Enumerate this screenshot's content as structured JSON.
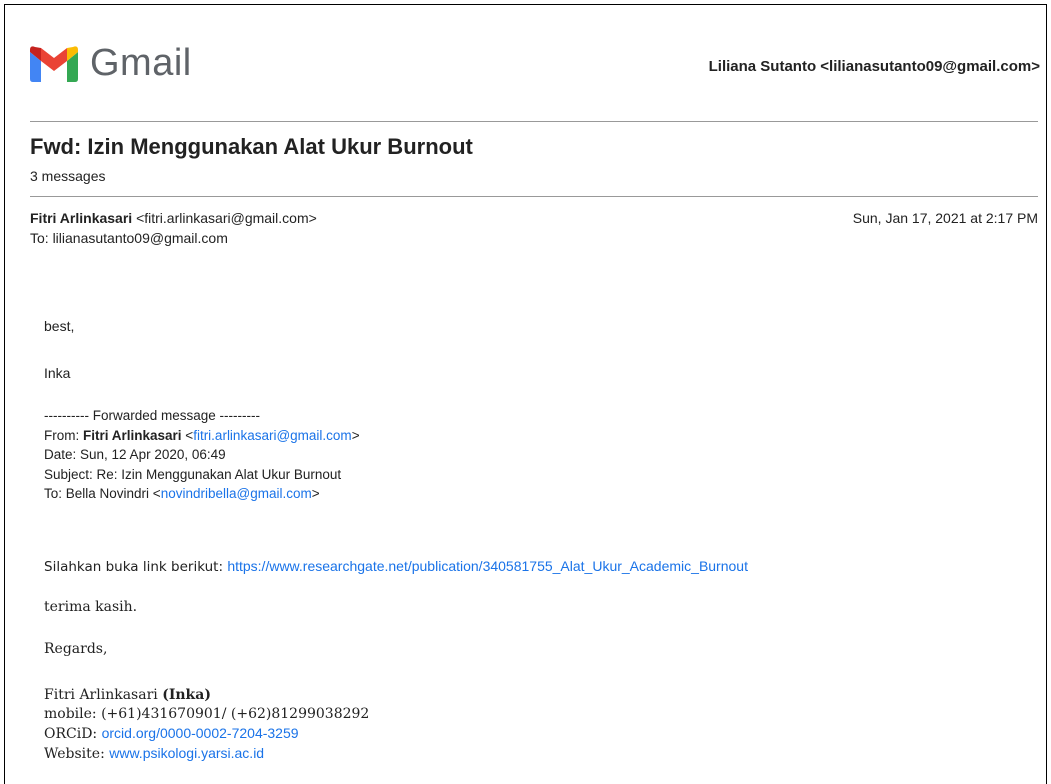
{
  "header": {
    "logo_text": "Gmail",
    "account": "Liliana Sutanto <lilianasutanto09@gmail.com>"
  },
  "thread": {
    "subject": "Fwd: Izin Menggunakan Alat Ukur Burnout",
    "message_count": "3 messages"
  },
  "message": {
    "sender_name": "Fitri Arlinkasari",
    "sender_email": "<fitri.arlinkasari@gmail.com>",
    "date": "Sun, Jan 17, 2021 at 2:17 PM",
    "to": "To: lilianasutanto09@gmail.com",
    "greeting": "best,",
    "signoff_name": "Inka",
    "forwarded": {
      "separator": "---------- Forwarded message ---------",
      "from_label": "From: ",
      "from_name": "Fitri Arlinkasari",
      "from_email_open": " <",
      "from_email": "fitri.arlinkasari@gmail.com",
      "from_email_close": ">",
      "date": "Date: Sun, 12 Apr 2020, 06:49",
      "subject": "Subject: Re: Izin Menggunakan Alat Ukur Burnout",
      "to_label": "To: Bella Novindri <",
      "to_email": "novindribella@gmail.com",
      "to_close": ">"
    },
    "link_intro": "Silahkan buka link berikut: ",
    "link_url": "https://www.researchgate.net/publication/340581755_Alat_Ukur_Academic_Burnout",
    "thanks": "terima kasih.",
    "regards": "Regards,",
    "signature": {
      "name": "Fitri Arlinkasari ",
      "nickname": "(Inka)",
      "mobile": "mobile: (+61)431670901/ (+62)81299038292",
      "orcid_label": "ORCiD: ",
      "orcid_link": "orcid.org/0000-0002-7204-3259",
      "website_label": "Website: ",
      "website_link": "www.psikologi.yarsi.ac.id"
    }
  },
  "colors": {
    "link": "#1a73e8",
    "gmail_red": "#ea4335",
    "gmail_blue": "#4285f4",
    "gmail_green": "#34a853",
    "gmail_yellow": "#fbbc04"
  }
}
